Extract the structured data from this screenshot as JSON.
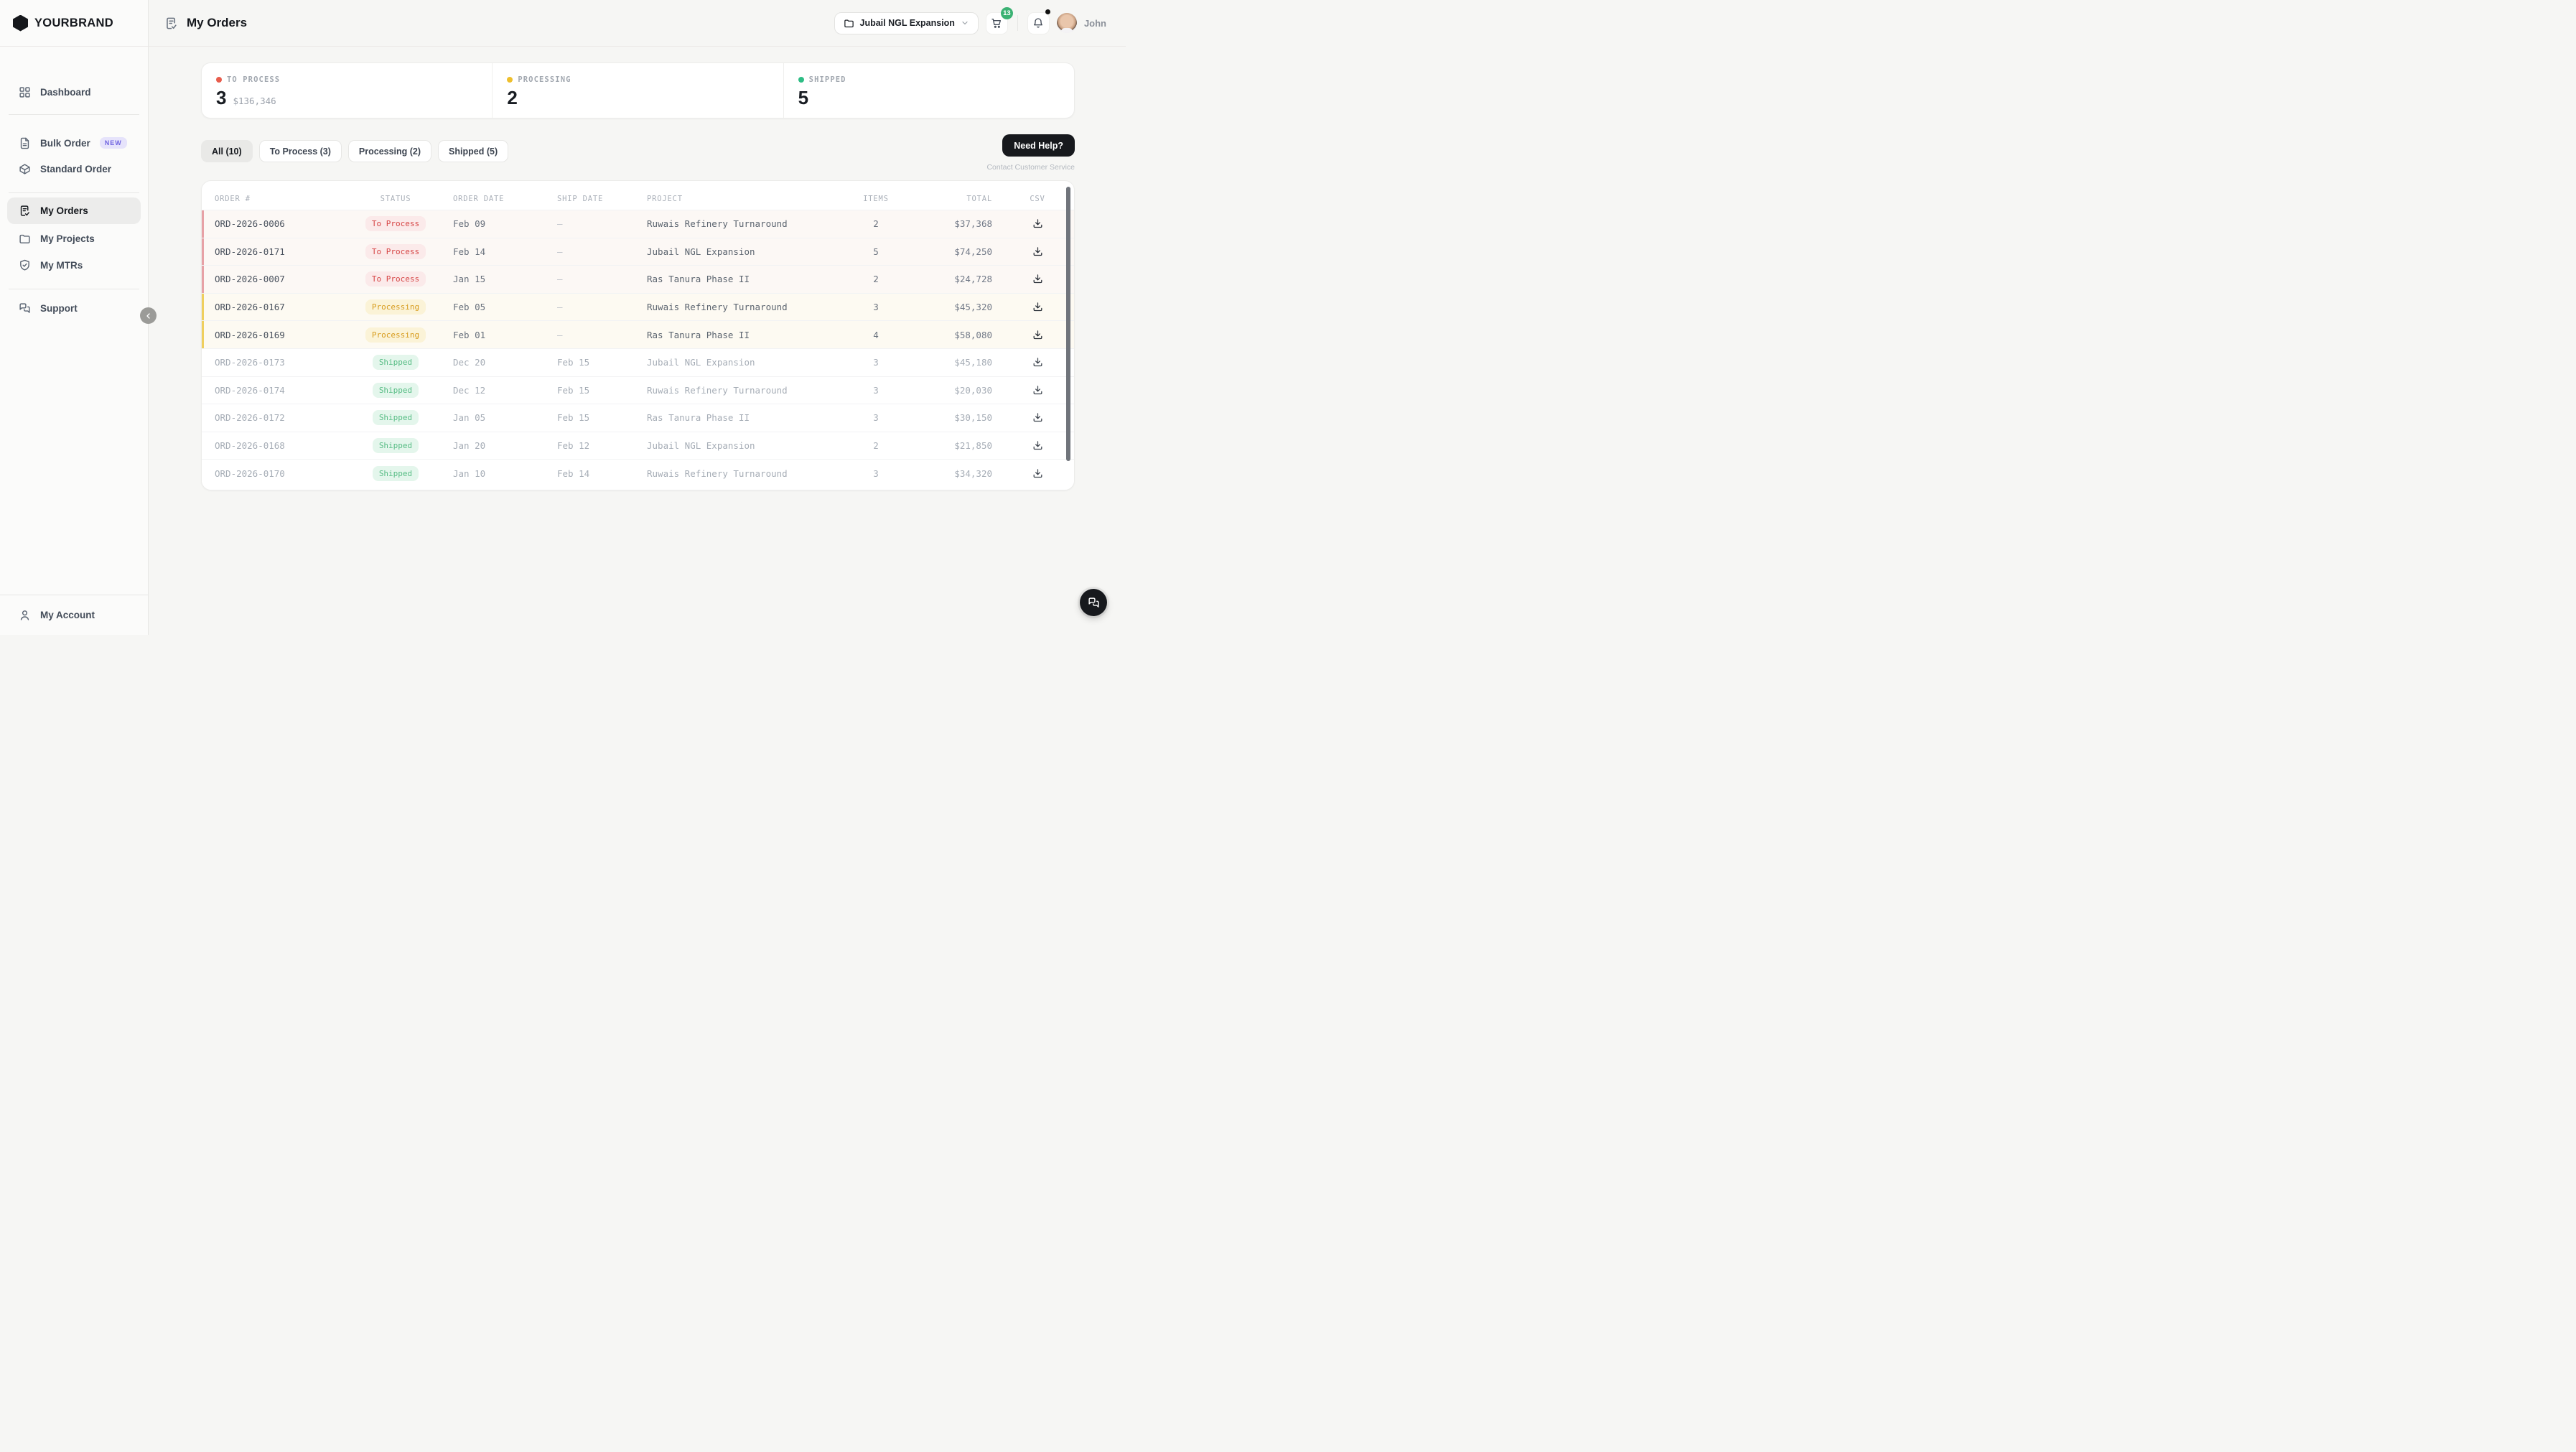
{
  "brand": {
    "name": "YOURBRAND"
  },
  "sidebar": {
    "items": [
      {
        "label": "Dashboard"
      },
      {
        "label": "Bulk Order",
        "badge": "NEW"
      },
      {
        "label": "Standard Order"
      },
      {
        "label": "My Orders",
        "active": true
      },
      {
        "label": "My Projects"
      },
      {
        "label": "My MTRs"
      },
      {
        "label": "Support"
      }
    ],
    "account_label": "My Account"
  },
  "header": {
    "title": "My Orders",
    "project_selector": "Jubail NGL Expansion",
    "cart_badge": "13",
    "user_name": "John"
  },
  "stats": [
    {
      "label": "TO PROCESS",
      "value": "3",
      "sub": "$136,346",
      "dot_color": "#e85d4d"
    },
    {
      "label": "PROCESSING",
      "value": "2",
      "sub": "",
      "dot_color": "#eebf2d"
    },
    {
      "label": "SHIPPED",
      "value": "5",
      "sub": "",
      "dot_color": "#2ebd85"
    }
  ],
  "tabs": [
    {
      "label": "All (10)",
      "active": true
    },
    {
      "label": "To Process (3)",
      "active": false
    },
    {
      "label": "Processing (2)",
      "active": false
    },
    {
      "label": "Shipped (5)",
      "active": false
    }
  ],
  "help": {
    "button_label": "Need Help?",
    "caption": "Contact Customer Service"
  },
  "table": {
    "columns": [
      "ORDER #",
      "STATUS",
      "ORDER DATE",
      "SHIP DATE",
      "PROJECT",
      "ITEMS",
      "TOTAL",
      "CSV"
    ],
    "status_colors": {
      "To Process": {
        "text": "#d64545",
        "bg": "#fbeaea",
        "row_border": "#e7a1a6"
      },
      "Processing": {
        "text": "#d79b1d",
        "bg": "#fbf3d7",
        "row_border": "#efcf5e"
      },
      "Shipped": {
        "text": "#58bd85",
        "bg": "#e4f6ec",
        "row_border": ""
      }
    },
    "rows": [
      {
        "order": "ORD-2026-0006",
        "status": "To Process",
        "order_date": "Feb 09",
        "ship_date": "–",
        "project": "Ruwais Refinery Turnaround",
        "items": "2",
        "total": "$37,368"
      },
      {
        "order": "ORD-2026-0171",
        "status": "To Process",
        "order_date": "Feb 14",
        "ship_date": "–",
        "project": "Jubail NGL Expansion",
        "items": "5",
        "total": "$74,250"
      },
      {
        "order": "ORD-2026-0007",
        "status": "To Process",
        "order_date": "Jan 15",
        "ship_date": "–",
        "project": "Ras Tanura Phase II",
        "items": "2",
        "total": "$24,728"
      },
      {
        "order": "ORD-2026-0167",
        "status": "Processing",
        "order_date": "Feb 05",
        "ship_date": "–",
        "project": "Ruwais Refinery Turnaround",
        "items": "3",
        "total": "$45,320"
      },
      {
        "order": "ORD-2026-0169",
        "status": "Processing",
        "order_date": "Feb 01",
        "ship_date": "–",
        "project": "Ras Tanura Phase II",
        "items": "4",
        "total": "$58,080"
      },
      {
        "order": "ORD-2026-0173",
        "status": "Shipped",
        "order_date": "Dec 20",
        "ship_date": "Feb 15",
        "project": "Jubail NGL Expansion",
        "items": "3",
        "total": "$45,180"
      },
      {
        "order": "ORD-2026-0174",
        "status": "Shipped",
        "order_date": "Dec 12",
        "ship_date": "Feb 15",
        "project": "Ruwais Refinery Turnaround",
        "items": "3",
        "total": "$20,030"
      },
      {
        "order": "ORD-2026-0172",
        "status": "Shipped",
        "order_date": "Jan 05",
        "ship_date": "Feb 15",
        "project": "Ras Tanura Phase II",
        "items": "3",
        "total": "$30,150"
      },
      {
        "order": "ORD-2026-0168",
        "status": "Shipped",
        "order_date": "Jan 20",
        "ship_date": "Feb 12",
        "project": "Jubail NGL Expansion",
        "items": "2",
        "total": "$21,850"
      },
      {
        "order": "ORD-2026-0170",
        "status": "Shipped",
        "order_date": "Jan 10",
        "ship_date": "Feb 14",
        "project": "Ruwais Refinery Turnaround",
        "items": "3",
        "total": "$34,320"
      }
    ]
  }
}
